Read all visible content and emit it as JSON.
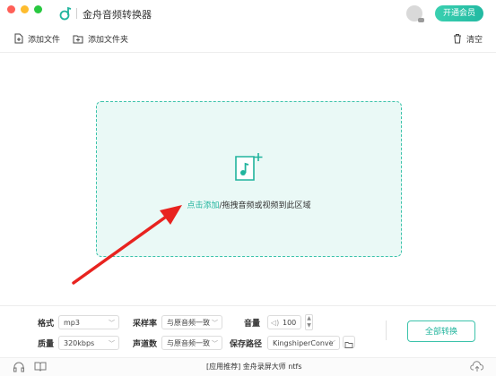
{
  "app": {
    "title": "金舟音频转换器",
    "vip_label": "开通会员"
  },
  "toolbar": {
    "add_file": "添加文件",
    "add_folder": "添加文件夹",
    "clear": "清空"
  },
  "drop_zone": {
    "link_text": "点击添加",
    "text": "/拖拽音频或视频到此区域"
  },
  "settings": {
    "format_label": "格式",
    "format_value": "mp3",
    "quality_label": "质量",
    "quality_value": "320kbps",
    "sample_rate_label": "采样率",
    "sample_rate_value": "与原音频一致",
    "channels_label": "声道数",
    "channels_value": "与原音频一致",
    "volume_label": "音量",
    "volume_value": "100",
    "save_path_label": "保存路径",
    "save_path_value": "KingshiperConve",
    "convert_all": "全部转换"
  },
  "footer": {
    "promo": "[应用推荐]  金舟录屏大师   ntfs"
  },
  "colors": {
    "accent": "#21b49d",
    "drop_bg": "#eaf9f6",
    "arrow": "#e8231f"
  }
}
